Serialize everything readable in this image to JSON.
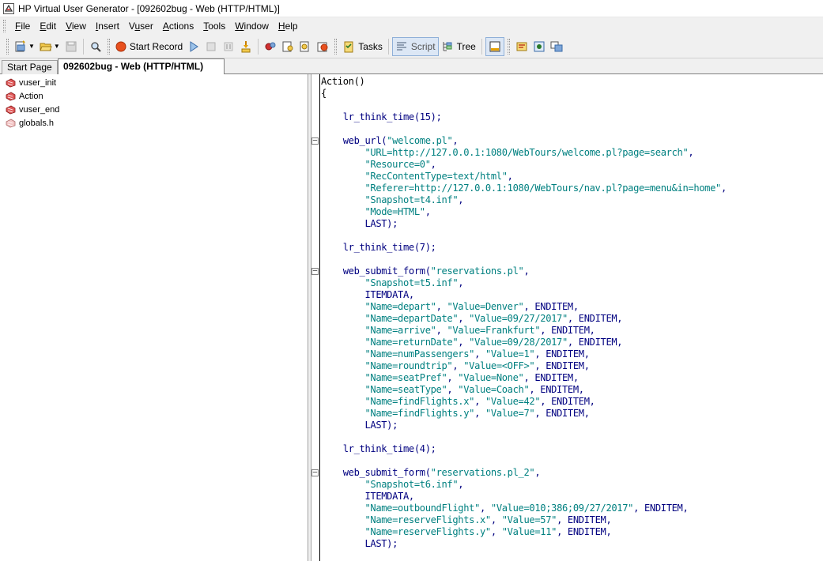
{
  "window": {
    "title": "HP Virtual User Generator - [092602bug - Web (HTTP/HTML)]"
  },
  "menu": [
    {
      "label": "File",
      "acc": "F",
      "rest": "ile"
    },
    {
      "label": "Edit",
      "acc": "E",
      "rest": "dit"
    },
    {
      "label": "View",
      "acc": "V",
      "rest": "iew"
    },
    {
      "label": "Insert",
      "acc": "I",
      "rest": "nsert"
    },
    {
      "label": "Vuser",
      "pre": "V",
      "acc": "u",
      "rest": "ser"
    },
    {
      "label": "Actions",
      "acc": "A",
      "rest": "ctions"
    },
    {
      "label": "Tools",
      "acc": "T",
      "rest": "ools"
    },
    {
      "label": "Window",
      "acc": "W",
      "rest": "indow"
    },
    {
      "label": "Help",
      "acc": "H",
      "rest": "elp"
    }
  ],
  "toolbar": {
    "start_record": "Start Record",
    "tasks": "Tasks",
    "script": "Script",
    "tree": "Tree"
  },
  "tabs": [
    {
      "label": "Start Page"
    },
    {
      "label": "092602bug - Web (HTTP/HTML)"
    }
  ],
  "tree_items": [
    {
      "label": "vuser_init",
      "icon": "action-icon"
    },
    {
      "label": "Action",
      "icon": "action-icon"
    },
    {
      "label": "vuser_end",
      "icon": "action-icon"
    },
    {
      "label": "globals.h",
      "icon": "header-file-icon"
    }
  ],
  "colors": {
    "keyword": "#000080",
    "string": "#008080",
    "active_tab_bg": "#ffffff",
    "panel_bg": "#f0f0f0"
  },
  "code_lines": [
    {
      "fold": false,
      "parts": [
        {
          "t": "Action()",
          "c": "plain"
        }
      ]
    },
    {
      "fold": false,
      "parts": [
        {
          "t": "{",
          "c": "plain"
        }
      ]
    },
    {
      "fold": false,
      "parts": []
    },
    {
      "fold": false,
      "parts": [
        {
          "t": "    ",
          "c": "plain"
        },
        {
          "t": "lr_think_time",
          "c": "fn"
        },
        {
          "t": "(15);",
          "c": "kw"
        }
      ]
    },
    {
      "fold": false,
      "parts": []
    },
    {
      "fold": true,
      "parts": [
        {
          "t": "    ",
          "c": "plain"
        },
        {
          "t": "web_url",
          "c": "fn"
        },
        {
          "t": "(",
          "c": "kw"
        },
        {
          "t": "\"welcome.pl\"",
          "c": "str"
        },
        {
          "t": ",",
          "c": "kw"
        }
      ]
    },
    {
      "fold": false,
      "parts": [
        {
          "t": "        ",
          "c": "plain"
        },
        {
          "t": "\"URL=http://127.0.0.1:1080/WebTours/welcome.pl?page=search\"",
          "c": "str"
        },
        {
          "t": ",",
          "c": "kw"
        }
      ]
    },
    {
      "fold": false,
      "parts": [
        {
          "t": "        ",
          "c": "plain"
        },
        {
          "t": "\"Resource=0\"",
          "c": "str"
        },
        {
          "t": ",",
          "c": "kw"
        }
      ]
    },
    {
      "fold": false,
      "parts": [
        {
          "t": "        ",
          "c": "plain"
        },
        {
          "t": "\"RecContentType=text/html\"",
          "c": "str"
        },
        {
          "t": ",",
          "c": "kw"
        }
      ]
    },
    {
      "fold": false,
      "parts": [
        {
          "t": "        ",
          "c": "plain"
        },
        {
          "t": "\"Referer=http://127.0.0.1:1080/WebTours/nav.pl?page=menu&in=home\"",
          "c": "str"
        },
        {
          "t": ",",
          "c": "kw"
        }
      ]
    },
    {
      "fold": false,
      "parts": [
        {
          "t": "        ",
          "c": "plain"
        },
        {
          "t": "\"Snapshot=t4.inf\"",
          "c": "str"
        },
        {
          "t": ",",
          "c": "kw"
        }
      ]
    },
    {
      "fold": false,
      "parts": [
        {
          "t": "        ",
          "c": "plain"
        },
        {
          "t": "\"Mode=HTML\"",
          "c": "str"
        },
        {
          "t": ",",
          "c": "kw"
        }
      ]
    },
    {
      "fold": false,
      "parts": [
        {
          "t": "        ",
          "c": "plain"
        },
        {
          "t": "LAST);",
          "c": "kw"
        }
      ]
    },
    {
      "fold": false,
      "parts": []
    },
    {
      "fold": false,
      "parts": [
        {
          "t": "    ",
          "c": "plain"
        },
        {
          "t": "lr_think_time",
          "c": "fn"
        },
        {
          "t": "(7);",
          "c": "kw"
        }
      ]
    },
    {
      "fold": false,
      "parts": []
    },
    {
      "fold": true,
      "parts": [
        {
          "t": "    ",
          "c": "plain"
        },
        {
          "t": "web_submit_form",
          "c": "fn"
        },
        {
          "t": "(",
          "c": "kw"
        },
        {
          "t": "\"reservations.pl\"",
          "c": "str"
        },
        {
          "t": ",",
          "c": "kw"
        }
      ]
    },
    {
      "fold": false,
      "parts": [
        {
          "t": "        ",
          "c": "plain"
        },
        {
          "t": "\"Snapshot=t5.inf\"",
          "c": "str"
        },
        {
          "t": ",",
          "c": "kw"
        }
      ]
    },
    {
      "fold": false,
      "parts": [
        {
          "t": "        ",
          "c": "plain"
        },
        {
          "t": "ITEMDATA,",
          "c": "kw"
        }
      ]
    },
    {
      "fold": false,
      "parts": [
        {
          "t": "        ",
          "c": "plain"
        },
        {
          "t": "\"Name=depart\"",
          "c": "str"
        },
        {
          "t": ", ",
          "c": "kw"
        },
        {
          "t": "\"Value=Denver\"",
          "c": "str"
        },
        {
          "t": ", ENDITEM,",
          "c": "kw"
        }
      ]
    },
    {
      "fold": false,
      "parts": [
        {
          "t": "        ",
          "c": "plain"
        },
        {
          "t": "\"Name=departDate\"",
          "c": "str"
        },
        {
          "t": ", ",
          "c": "kw"
        },
        {
          "t": "\"Value=09/27/2017\"",
          "c": "str"
        },
        {
          "t": ", ENDITEM,",
          "c": "kw"
        }
      ]
    },
    {
      "fold": false,
      "parts": [
        {
          "t": "        ",
          "c": "plain"
        },
        {
          "t": "\"Name=arrive\"",
          "c": "str"
        },
        {
          "t": ", ",
          "c": "kw"
        },
        {
          "t": "\"Value=Frankfurt\"",
          "c": "str"
        },
        {
          "t": ", ENDITEM,",
          "c": "kw"
        }
      ]
    },
    {
      "fold": false,
      "parts": [
        {
          "t": "        ",
          "c": "plain"
        },
        {
          "t": "\"Name=returnDate\"",
          "c": "str"
        },
        {
          "t": ", ",
          "c": "kw"
        },
        {
          "t": "\"Value=09/28/2017\"",
          "c": "str"
        },
        {
          "t": ", ENDITEM,",
          "c": "kw"
        }
      ]
    },
    {
      "fold": false,
      "parts": [
        {
          "t": "        ",
          "c": "plain"
        },
        {
          "t": "\"Name=numPassengers\"",
          "c": "str"
        },
        {
          "t": ", ",
          "c": "kw"
        },
        {
          "t": "\"Value=1\"",
          "c": "str"
        },
        {
          "t": ", ENDITEM,",
          "c": "kw"
        }
      ]
    },
    {
      "fold": false,
      "parts": [
        {
          "t": "        ",
          "c": "plain"
        },
        {
          "t": "\"Name=roundtrip\"",
          "c": "str"
        },
        {
          "t": ", ",
          "c": "kw"
        },
        {
          "t": "\"Value=<OFF>\"",
          "c": "str"
        },
        {
          "t": ", ENDITEM,",
          "c": "kw"
        }
      ]
    },
    {
      "fold": false,
      "parts": [
        {
          "t": "        ",
          "c": "plain"
        },
        {
          "t": "\"Name=seatPref\"",
          "c": "str"
        },
        {
          "t": ", ",
          "c": "kw"
        },
        {
          "t": "\"Value=None\"",
          "c": "str"
        },
        {
          "t": ", ENDITEM,",
          "c": "kw"
        }
      ]
    },
    {
      "fold": false,
      "parts": [
        {
          "t": "        ",
          "c": "plain"
        },
        {
          "t": "\"Name=seatType\"",
          "c": "str"
        },
        {
          "t": ", ",
          "c": "kw"
        },
        {
          "t": "\"Value=Coach\"",
          "c": "str"
        },
        {
          "t": ", ENDITEM,",
          "c": "kw"
        }
      ]
    },
    {
      "fold": false,
      "parts": [
        {
          "t": "        ",
          "c": "plain"
        },
        {
          "t": "\"Name=findFlights.x\"",
          "c": "str"
        },
        {
          "t": ", ",
          "c": "kw"
        },
        {
          "t": "\"Value=42\"",
          "c": "str"
        },
        {
          "t": ", ENDITEM,",
          "c": "kw"
        }
      ]
    },
    {
      "fold": false,
      "parts": [
        {
          "t": "        ",
          "c": "plain"
        },
        {
          "t": "\"Name=findFlights.y\"",
          "c": "str"
        },
        {
          "t": ", ",
          "c": "kw"
        },
        {
          "t": "\"Value=7\"",
          "c": "str"
        },
        {
          "t": ", ENDITEM,",
          "c": "kw"
        }
      ]
    },
    {
      "fold": false,
      "parts": [
        {
          "t": "        ",
          "c": "plain"
        },
        {
          "t": "LAST);",
          "c": "kw"
        }
      ]
    },
    {
      "fold": false,
      "parts": []
    },
    {
      "fold": false,
      "parts": [
        {
          "t": "    ",
          "c": "plain"
        },
        {
          "t": "lr_think_time",
          "c": "fn"
        },
        {
          "t": "(4);",
          "c": "kw"
        }
      ]
    },
    {
      "fold": false,
      "parts": []
    },
    {
      "fold": true,
      "parts": [
        {
          "t": "    ",
          "c": "plain"
        },
        {
          "t": "web_submit_form",
          "c": "fn"
        },
        {
          "t": "(",
          "c": "kw"
        },
        {
          "t": "\"reservations.pl_2\"",
          "c": "str"
        },
        {
          "t": ",",
          "c": "kw"
        }
      ]
    },
    {
      "fold": false,
      "parts": [
        {
          "t": "        ",
          "c": "plain"
        },
        {
          "t": "\"Snapshot=t6.inf\"",
          "c": "str"
        },
        {
          "t": ",",
          "c": "kw"
        }
      ]
    },
    {
      "fold": false,
      "parts": [
        {
          "t": "        ",
          "c": "plain"
        },
        {
          "t": "ITEMDATA,",
          "c": "kw"
        }
      ]
    },
    {
      "fold": false,
      "parts": [
        {
          "t": "        ",
          "c": "plain"
        },
        {
          "t": "\"Name=outboundFlight\"",
          "c": "str"
        },
        {
          "t": ", ",
          "c": "kw"
        },
        {
          "t": "\"Value=010;386;09/27/2017\"",
          "c": "str"
        },
        {
          "t": ", ENDITEM,",
          "c": "kw"
        }
      ]
    },
    {
      "fold": false,
      "parts": [
        {
          "t": "        ",
          "c": "plain"
        },
        {
          "t": "\"Name=reserveFlights.x\"",
          "c": "str"
        },
        {
          "t": ", ",
          "c": "kw"
        },
        {
          "t": "\"Value=57\"",
          "c": "str"
        },
        {
          "t": ", ENDITEM,",
          "c": "kw"
        }
      ]
    },
    {
      "fold": false,
      "parts": [
        {
          "t": "        ",
          "c": "plain"
        },
        {
          "t": "\"Name=reserveFlights.y\"",
          "c": "str"
        },
        {
          "t": ", ",
          "c": "kw"
        },
        {
          "t": "\"Value=11\"",
          "c": "str"
        },
        {
          "t": ", ENDITEM,",
          "c": "kw"
        }
      ]
    },
    {
      "fold": false,
      "parts": [
        {
          "t": "        ",
          "c": "plain"
        },
        {
          "t": "LAST);",
          "c": "kw"
        }
      ]
    }
  ]
}
